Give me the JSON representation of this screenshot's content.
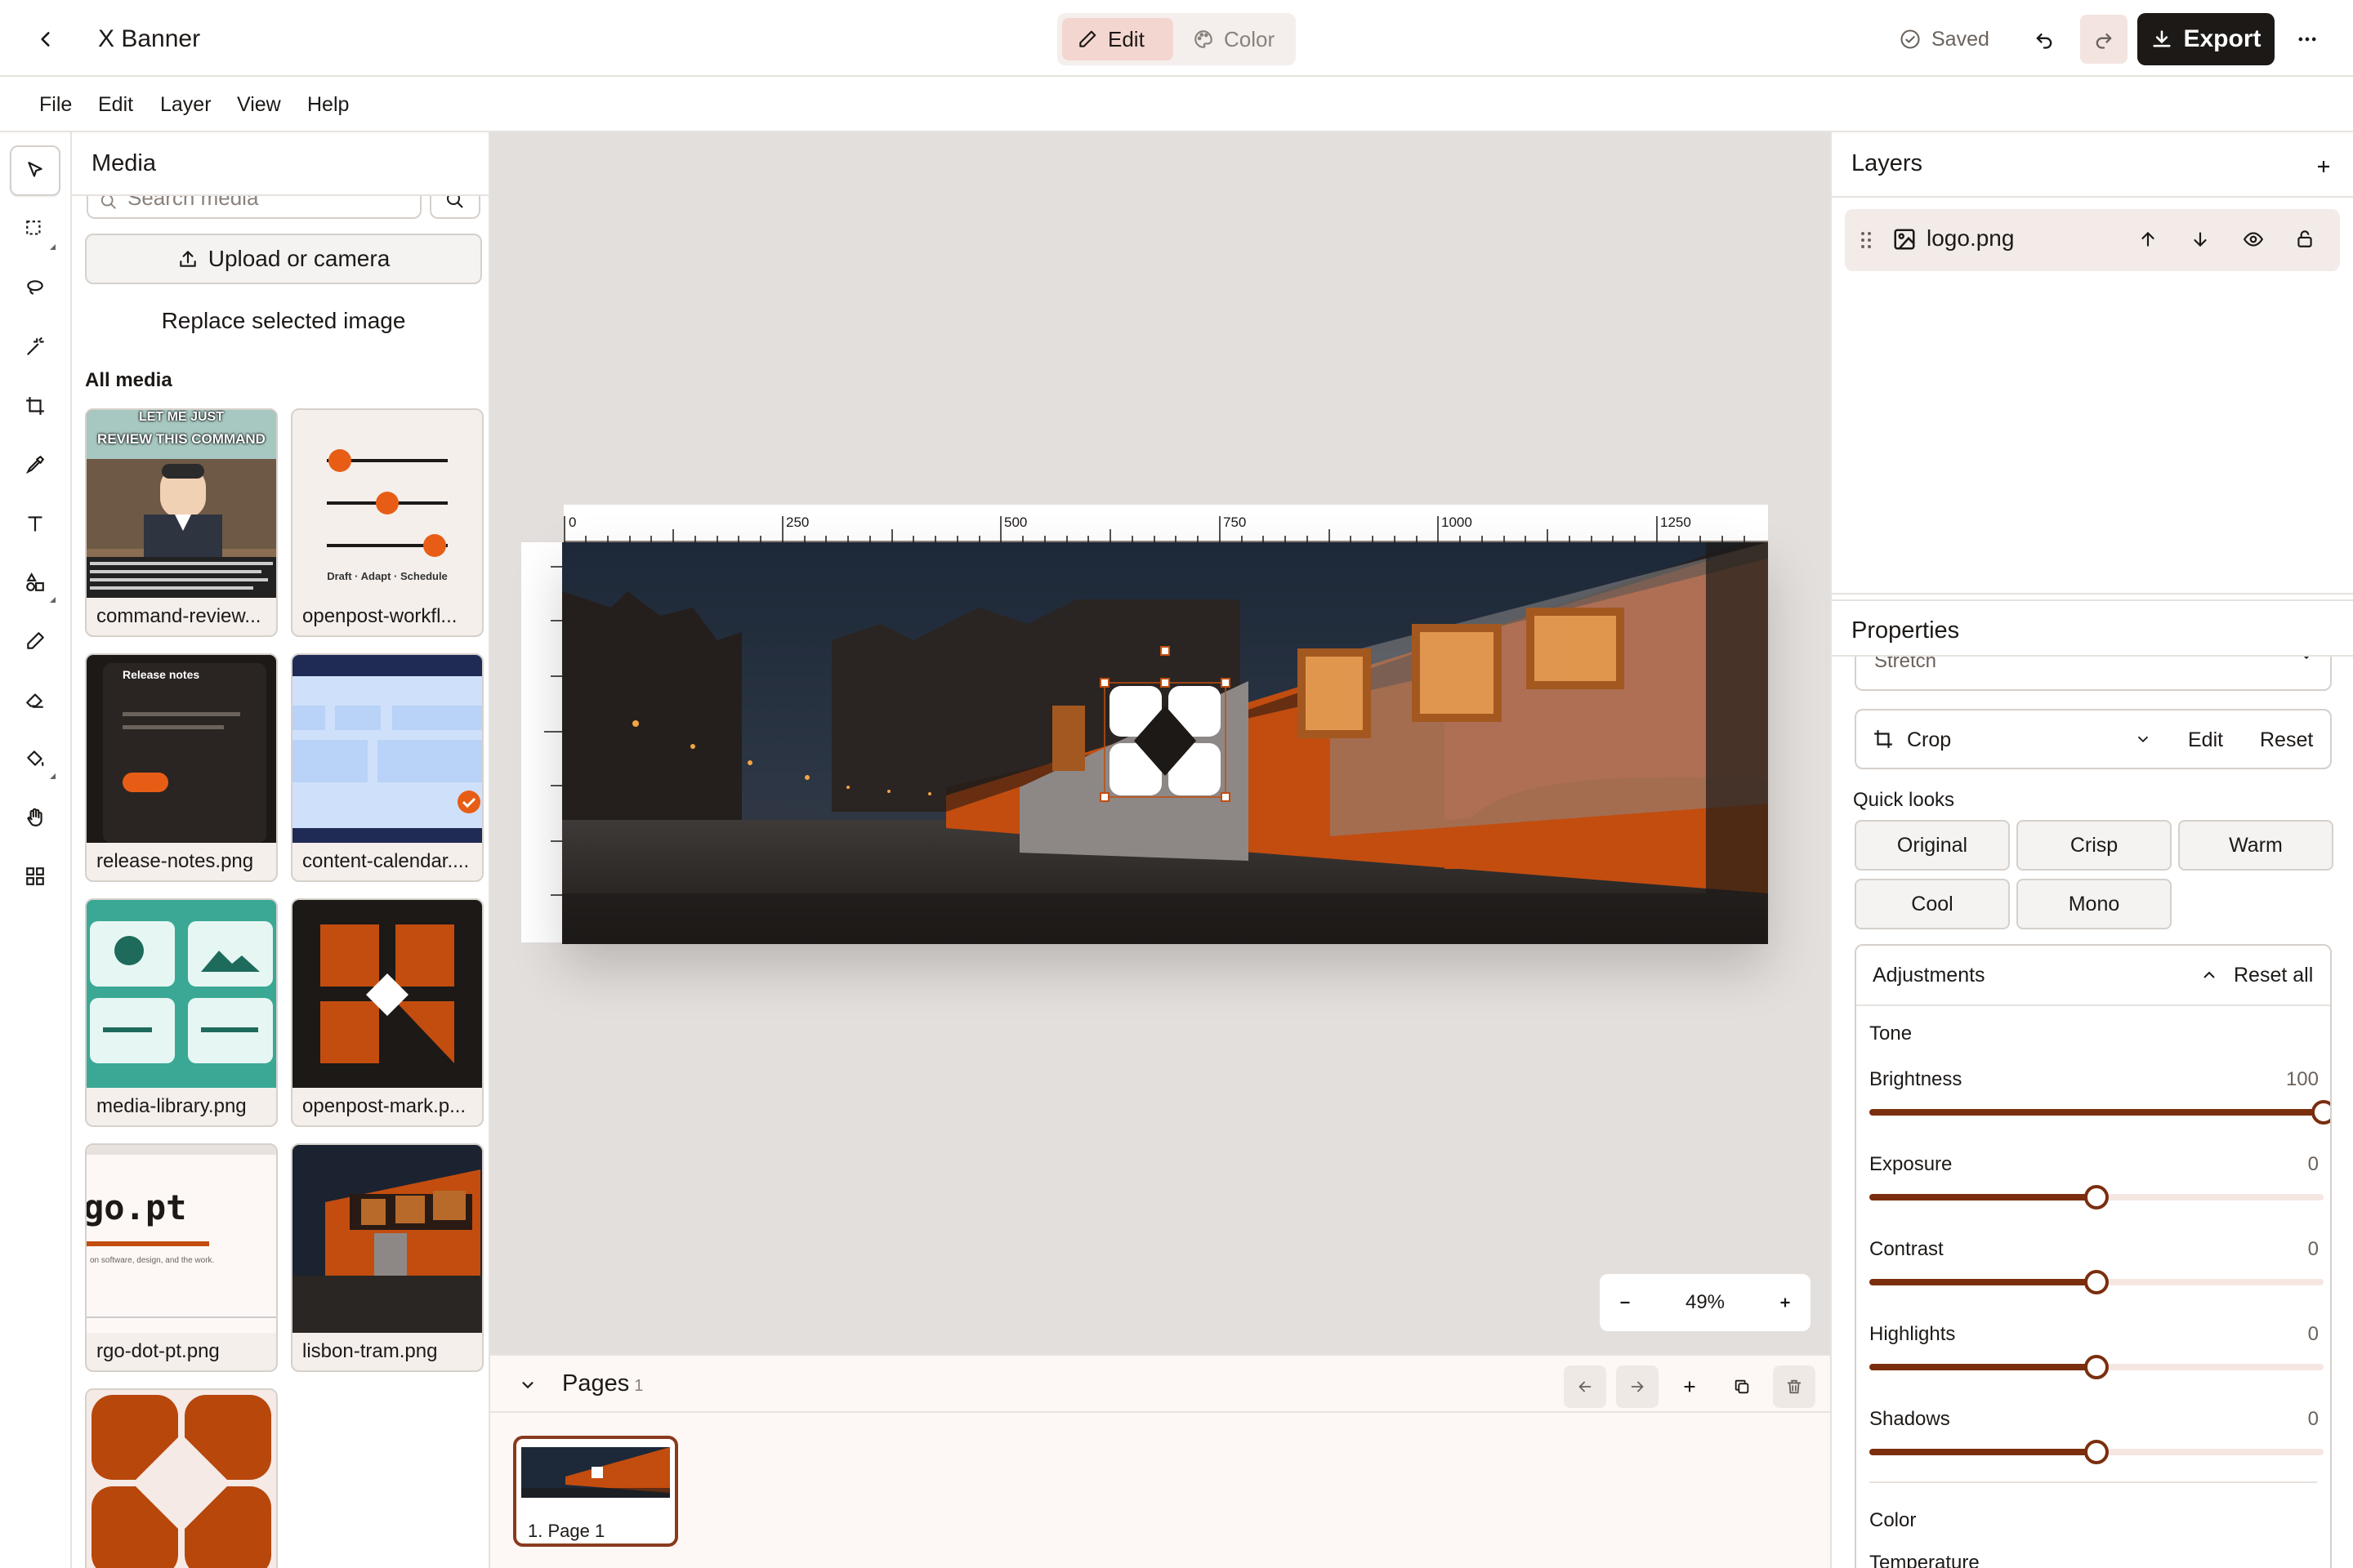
{
  "app": {
    "title": "X Banner"
  },
  "topbar": {
    "modes": [
      {
        "label": "Edit",
        "active": true
      },
      {
        "label": "Color",
        "active": false
      }
    ],
    "saved_label": "Saved",
    "export_label": "Export",
    "accent": "#7a2e0e"
  },
  "menu": [
    "File",
    "Edit",
    "Layer",
    "View",
    "Help"
  ],
  "tools": [
    "select-icon",
    "marquee-icon",
    "lasso-icon",
    "magic-wand-icon",
    "crop-icon",
    "eyedropper-icon",
    "text-icon",
    "shapes-icon",
    "brush-icon",
    "eraser-icon",
    "fill-bucket-icon",
    "hand-icon",
    "grid-icon"
  ],
  "media": {
    "title": "Media",
    "search_placeholder": "Search media",
    "upload_label": "Upload or camera",
    "replace_label": "Replace selected image",
    "section_label": "All media",
    "cmd_top": "LET ME JUST",
    "cmd_mid": "REVIEW THIS COMMAND",
    "workflow_caption": "Draft · Adapt · Schedule",
    "release_title": "Release notes",
    "blog_word": "go.pt",
    "blog_line": "on software, design, and the work.",
    "items": [
      {
        "name": "command-review...",
        "kind": "meme"
      },
      {
        "name": "openpost-workfl...",
        "kind": "workflow"
      },
      {
        "name": "release-notes.png",
        "kind": "release"
      },
      {
        "name": "content-calendar....",
        "kind": "calendar"
      },
      {
        "name": "media-library.png",
        "kind": "library"
      },
      {
        "name": "openpost-mark.p...",
        "kind": "mark"
      },
      {
        "name": "rgo-dot-pt.png",
        "kind": "blog"
      },
      {
        "name": "lisbon-tram.png",
        "kind": "tram"
      },
      {
        "name": "",
        "kind": "logo"
      }
    ]
  },
  "canvas": {
    "ruler_marks": [
      "0",
      "250",
      "500",
      "750",
      "1000",
      "1250"
    ],
    "zoom": "49%"
  },
  "pages": {
    "title": "Pages",
    "count": "1",
    "items": [
      {
        "label": "1. Page 1"
      }
    ]
  },
  "layers": {
    "title": "Layers",
    "items": [
      {
        "name": "logo.png"
      }
    ]
  },
  "properties": {
    "title": "Properties",
    "fit_value": "Stretch",
    "crop_label": "Crop",
    "crop_edit": "Edit",
    "crop_reset": "Reset",
    "quick_looks_label": "Quick looks",
    "quick_looks": [
      "Original",
      "Crisp",
      "Warm",
      "Cool",
      "Mono"
    ],
    "adjustments_label": "Adjustments",
    "reset_all_label": "Reset all",
    "tone_label": "Tone",
    "sliders": [
      {
        "label": "Brightness",
        "value": "100",
        "fraction": 1.0
      },
      {
        "label": "Exposure",
        "value": "0",
        "fraction": 0.5
      },
      {
        "label": "Contrast",
        "value": "0",
        "fraction": 0.5
      },
      {
        "label": "Highlights",
        "value": "0",
        "fraction": 0.5
      },
      {
        "label": "Shadows",
        "value": "0",
        "fraction": 0.5
      }
    ],
    "color_label": "Color",
    "temperature_label": "Temperature"
  }
}
